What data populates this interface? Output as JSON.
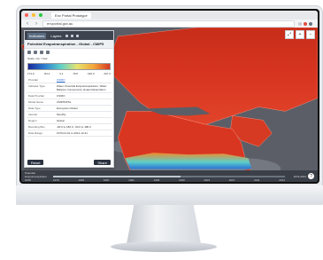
{
  "browser": {
    "tab_title": "Env Portal Prototype",
    "url": "envportal.gov.au"
  },
  "panel": {
    "tabs": [
      "Indicators",
      "Layers"
    ],
    "title": "Potential Evapotranspiration - Global - CMIP5",
    "scale_label": "Scale:  mm / Year",
    "legend_ticks": [
      "174.9",
      "-84.2",
      "3.1",
      "79.5",
      "160.3",
      "207.3"
    ],
    "meta": [
      {
        "k": "Provider",
        "v": "CSIRO",
        "link": true
      },
      {
        "k": "Indicator Type",
        "v": "Water, Potential Evapotranspiration, Water Balance Components, Evapotranspiration",
        "link": false
      },
      {
        "k": "Data Provider",
        "v": "CSIRO",
        "link": false
      },
      {
        "k": "Model Name",
        "v": "CMIP5/IPSL",
        "link": false
      },
      {
        "k": "Data Type",
        "v": "Ecosystem Model",
        "link": false
      },
      {
        "k": "Interval",
        "v": "Monthly",
        "link": false
      },
      {
        "k": "Region",
        "v": "Global",
        "link": false
      },
      {
        "k": "Bounding Box",
        "v": "-90.0 to 180.0, -90.0 to 180.0",
        "link": false
      },
      {
        "k": "Date Range",
        "v": "1979-01-01 to 2014-12-31",
        "link": false
      }
    ],
    "btn_left": "Reset",
    "btn_right": "Share"
  },
  "map_controls": [
    "⤢",
    "+",
    "−"
  ],
  "timeline": {
    "left_label": "Potential Evapotranspiration · 1979",
    "ticks": [
      "1979",
      "1983",
      "1987",
      "1991",
      "1995",
      "1999",
      "2003",
      "2007",
      "2011",
      "2014"
    ],
    "right_label": "1979-2014",
    "progress": 0.55
  },
  "colors": {
    "map_ocean": "#5b5e66",
    "land_hot": "#d93621",
    "land_warm": "#f08a2a",
    "band_blue": "#2f7fd6",
    "band_cyan": "#5fd0c7"
  }
}
